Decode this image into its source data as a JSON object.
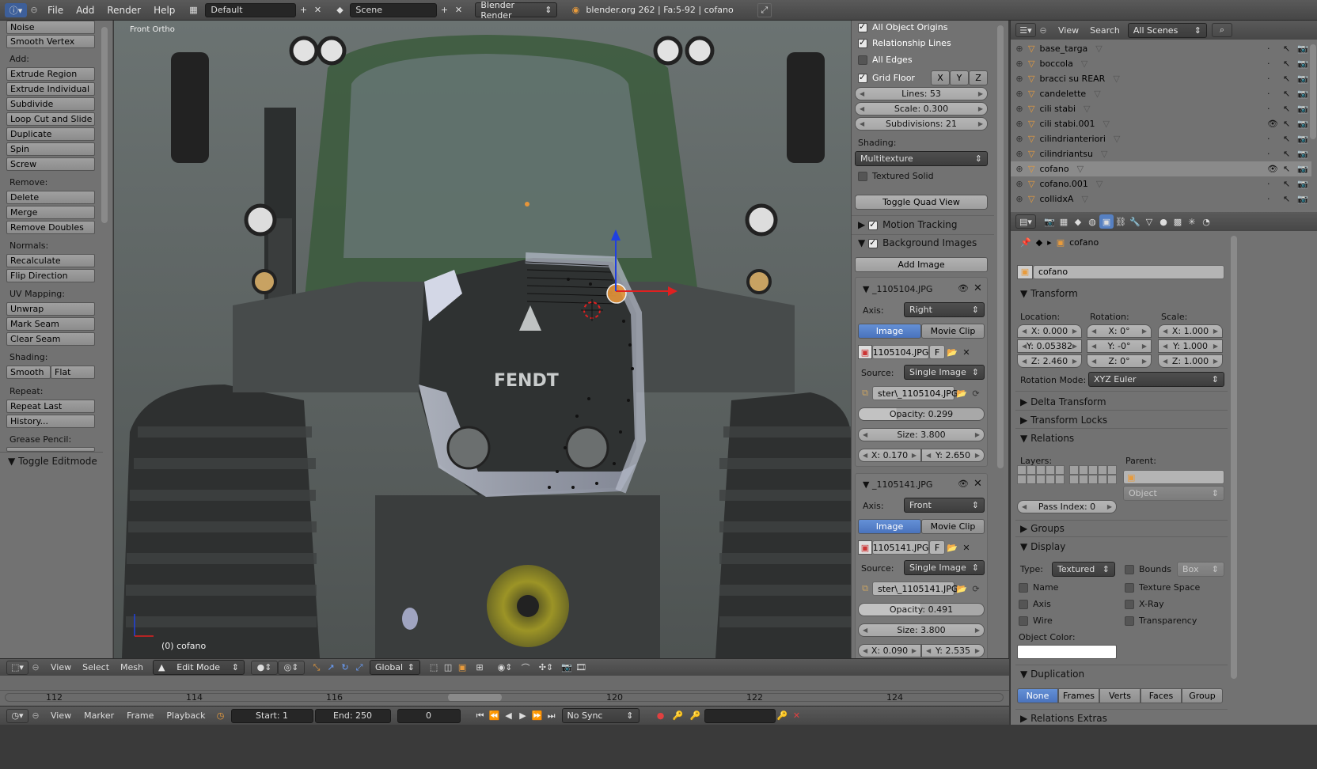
{
  "topbar": {
    "menus": [
      "File",
      "Add",
      "Render",
      "Help"
    ],
    "layout": "Default",
    "scene": "Scene",
    "engine": "Blender Render",
    "info": "blender.org 262 | Fa:5-92 | cofano"
  },
  "toolshelf": {
    "top_buttons": [
      "Noise",
      "Smooth Vertex"
    ],
    "add_label": "Add:",
    "add_buttons": [
      "Extrude Region",
      "Extrude Individual",
      "Subdivide",
      "Loop Cut and Slide",
      "Duplicate",
      "Spin",
      "Screw"
    ],
    "remove_label": "Remove:",
    "remove_buttons": [
      "Delete",
      "Merge",
      "Remove Doubles"
    ],
    "normals_label": "Normals:",
    "normals_buttons": [
      "Recalculate",
      "Flip Direction"
    ],
    "uv_label": "UV Mapping:",
    "uv_buttons": [
      "Unwrap",
      "Mark Seam",
      "Clear Seam"
    ],
    "shading_label": "Shading:",
    "shading_smooth": "Smooth",
    "shading_flat": "Flat",
    "repeat_label": "Repeat:",
    "repeat_buttons": [
      "Repeat Last",
      "History..."
    ],
    "grease_label": "Grease Pencil:",
    "toggle_editmode": "Toggle Editmode"
  },
  "viewport": {
    "view_label": "Front Ortho",
    "object_label": "(0) cofano",
    "brand_text": "FENDT"
  },
  "npanel": {
    "all_object_origins": "All Object Origins",
    "relationship_lines": "Relationship Lines",
    "all_edges": "All Edges",
    "grid_floor": "Grid Floor",
    "axes": [
      "X",
      "Y",
      "Z"
    ],
    "lines": "Lines: 53",
    "scale": "Scale: 0.300",
    "subdivisions": "Subdivisions: 21",
    "shading_label": "Shading:",
    "shading_value": "Multitexture",
    "textured_solid": "Textured Solid",
    "toggle_quad": "Toggle Quad View",
    "motion_tracking": "Motion Tracking",
    "background_images": "Background Images",
    "add_image": "Add Image",
    "images": [
      {
        "name": "_1105104.JPG",
        "axis": "Right",
        "file": "1105104.JPG",
        "source": "Single Image",
        "path": "ster\\_1105104.JPG",
        "opacity": "Opacity: 0.299",
        "size": "Size: 3.800",
        "x": "X: 0.170",
        "y": "Y: 2.650"
      },
      {
        "name": "_1105141.JPG",
        "axis": "Front",
        "file": "1105141.JPG",
        "source": "Single Image",
        "path": "ster\\_1105141.JPG",
        "opacity": "Opacity: 0.491",
        "size": "Size: 3.800",
        "x": "X: 0.090",
        "y": "Y: 2.535"
      }
    ],
    "axis_label": "Axis:",
    "image_tab": "Image",
    "movieclip_tab": "Movie Clip",
    "f_label": "F",
    "source_label": "Source:"
  },
  "outliner": {
    "view": "View",
    "search": "Search",
    "scenes": "All Scenes",
    "items": [
      "base_targa",
      "boccola",
      "bracci su REAR",
      "candelette",
      "cili stabi",
      "cili stabi.001",
      "cilindrianteriori",
      "cilindriantsu",
      "cofano",
      "cofano.001",
      "collidxA"
    ]
  },
  "properties": {
    "breadcrumb": "cofano",
    "object_name": "cofano",
    "transform": "Transform",
    "location_label": "Location:",
    "rotation_label": "Rotation:",
    "scale_label": "Scale:",
    "location": [
      "X: 0.000",
      "Y: 0.05382",
      "Z: 2.460"
    ],
    "rotation": [
      "X: 0°",
      "Y: -0°",
      "Z: 0°"
    ],
    "scale": [
      "X: 1.000",
      "Y: 1.000",
      "Z: 1.000"
    ],
    "rotation_mode_label": "Rotation Mode:",
    "rotation_mode": "XYZ Euler",
    "delta_transform": "Delta Transform",
    "transform_locks": "Transform Locks",
    "relations": "Relations",
    "layers_label": "Layers:",
    "parent_label": "Parent:",
    "parent_type": "Object",
    "pass_index": "Pass Index: 0",
    "groups": "Groups",
    "display": "Display",
    "type_label": "Type:",
    "type_value": "Textured",
    "bounds": "Bounds",
    "bounds_type": "Box",
    "name": "Name",
    "texture_space": "Texture Space",
    "axis": "Axis",
    "xray": "X-Ray",
    "wire": "Wire",
    "transparency": "Transparency",
    "object_color": "Object Color:",
    "duplication": "Duplication",
    "dup_options": [
      "None",
      "Frames",
      "Verts",
      "Faces",
      "Group"
    ],
    "relations_extras": "Relations Extras"
  },
  "view3d_header": {
    "menus": [
      "View",
      "Select",
      "Mesh"
    ],
    "mode": "Edit Mode",
    "orientation": "Global"
  },
  "timeline": {
    "ticks": [
      "112",
      "114",
      "116",
      "118",
      "120",
      "122",
      "124"
    ],
    "menus": [
      "View",
      "Marker",
      "Frame",
      "Playback"
    ],
    "start": "Start: 1",
    "end": "End: 250",
    "current": "0",
    "sync": "No Sync"
  },
  "colors": {
    "accent": "#5680c2",
    "panel": "#727272",
    "header": "#4d4d4d"
  }
}
